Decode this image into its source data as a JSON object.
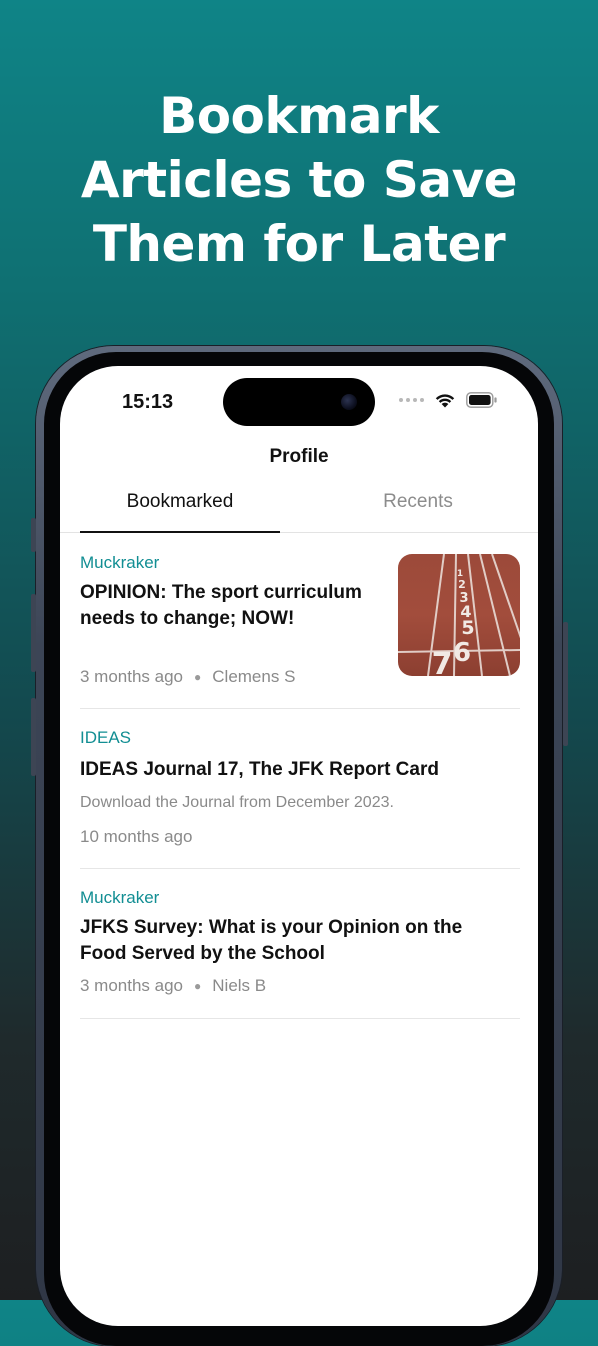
{
  "headline": {
    "line1": "Bookmark",
    "line2": "Articles to Save",
    "line3": "Them for Later"
  },
  "status_bar": {
    "time": "15:13",
    "icons": [
      "signal-dots-icon",
      "wifi-icon",
      "battery-icon"
    ]
  },
  "nav": {
    "title": "Profile"
  },
  "tabs": [
    {
      "label": "Bookmarked",
      "selected": true
    },
    {
      "label": "Recents",
      "selected": false
    }
  ],
  "articles": [
    {
      "source": "Muckraker",
      "title": "OPINION: The sport curriculum needs to change; NOW!",
      "time": "3 months ago",
      "author": "Clemens S",
      "has_thumbnail": true,
      "thumbnail_lane_numbers": [
        "1",
        "2",
        "3",
        "4",
        "5",
        "6",
        "7"
      ]
    },
    {
      "source": "IDEAS",
      "title": "IDEAS Journal 17, The JFK Report Card",
      "description": "Download the Journal from December 2023.",
      "time": "10 months ago"
    },
    {
      "source": "Muckraker",
      "title": "JFKS Survey: What is your Opinion on the Food Served by the School",
      "time": "3 months ago",
      "author": "Niels B"
    }
  ],
  "colors": {
    "accent": "#128e93",
    "background_top": "#0f8487",
    "background_bottom": "#1d1f21"
  }
}
